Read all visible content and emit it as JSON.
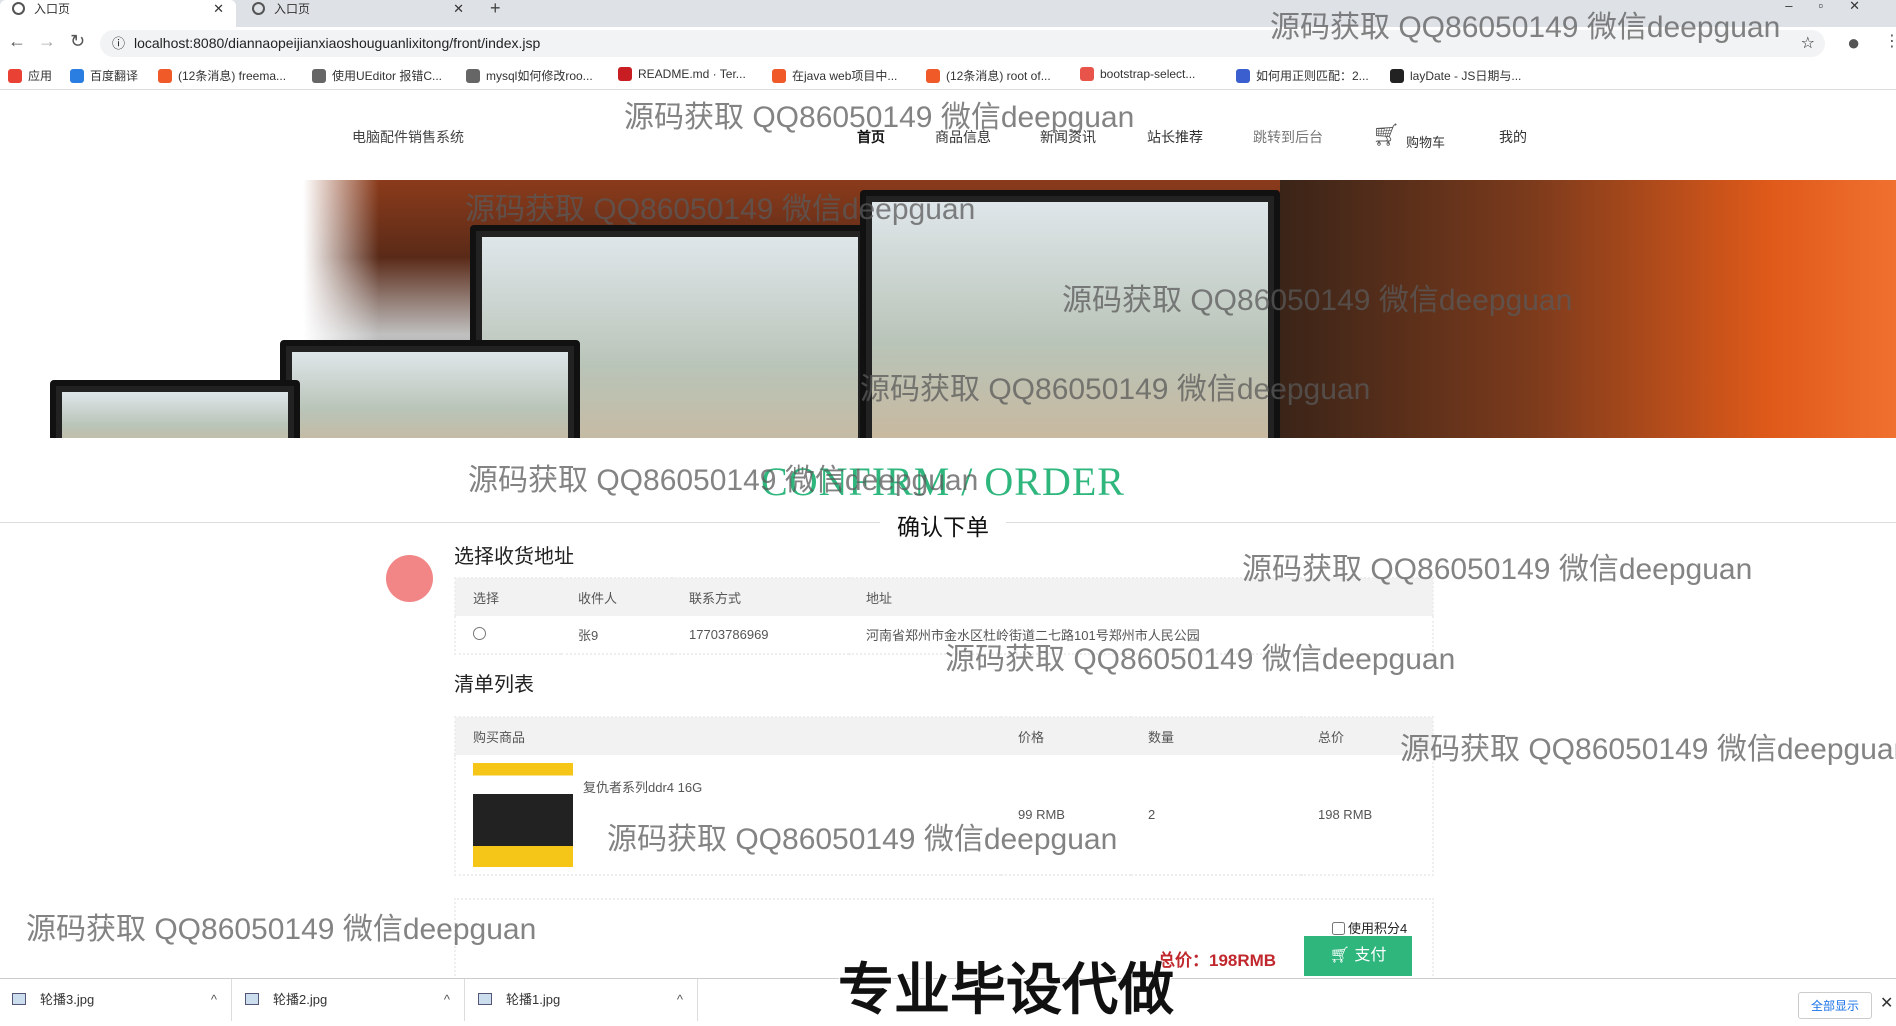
{
  "browser": {
    "tabs": [
      {
        "title": "入口页"
      },
      {
        "title": "入口页"
      }
    ],
    "new_tab": "+",
    "url": "localhost:8080/diannaopeijianxiaoshouguanlixitong/front/index.jsp",
    "bookmarks": [
      {
        "label": "应用",
        "color": "#e94235"
      },
      {
        "label": "百度翻译",
        "color": "#2a7de1"
      },
      {
        "label": "(12条消息) freema...",
        "color": "#f05a28"
      },
      {
        "label": "使用UEditor 报错C...",
        "color": "#666666"
      },
      {
        "label": "mysql如何修改roo...",
        "color": "#666666"
      },
      {
        "label": "README.md · Ter...",
        "color": "#c71d23"
      },
      {
        "label": "在java web项目中...",
        "color": "#f05a28"
      },
      {
        "label": "(12条消息) root of...",
        "color": "#f05a28"
      },
      {
        "label": "bootstrap-select...",
        "color": "#e9544a"
      },
      {
        "label": "如何用正则匹配：2...",
        "color": "#3b5fcf"
      },
      {
        "label": "layDate - JS日期与...",
        "color": "#222222"
      }
    ]
  },
  "site": {
    "title": "电脑配件销售系统",
    "nav": [
      "首页",
      "商品信息",
      "新闻资讯",
      "站长推荐",
      "跳转到后台",
      "购物车",
      "我的"
    ]
  },
  "page": {
    "heading_en": "CONFIRM / ORDER",
    "heading_cn": "确认下单",
    "address_section": "选择收货地址",
    "address_headers": [
      "选择",
      "收件人",
      "联系方式",
      "地址"
    ],
    "address_rows": [
      {
        "name": "张9",
        "phone": "17703786969",
        "address": "河南省郑州市金水区杜岭街道二七路101号郑州市人民公园"
      }
    ],
    "list_section": "清单列表",
    "list_headers": [
      "购买商品",
      "价格",
      "数量",
      "总价"
    ],
    "items": [
      {
        "name": "复仇者系列ddr4 16G",
        "price": "99 RMB",
        "qty": "2",
        "total": "198 RMB"
      }
    ],
    "use_points": "使用积分4",
    "total": "总价：198RMB",
    "pay": "支付"
  },
  "downloads": {
    "files": [
      "轮播3.jpg",
      "轮播2.jpg",
      "轮播1.jpg"
    ],
    "show_all": "全部显示"
  },
  "overlay": {
    "watermark": "源码获取 QQ86050149 微信deepguan",
    "promo": "专业毕设代做"
  },
  "colors": {
    "accent": "#2eb67d",
    "price": "#c0282d"
  }
}
